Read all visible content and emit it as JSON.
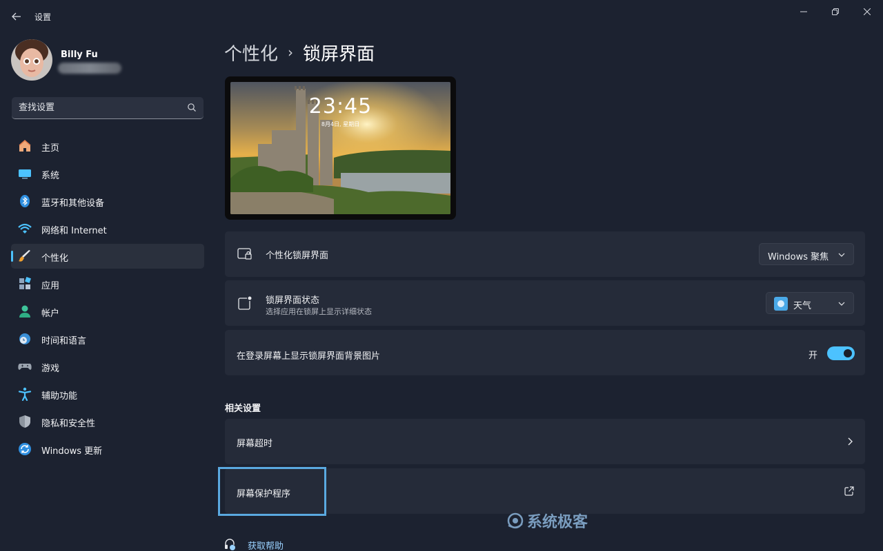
{
  "window": {
    "title": "设置",
    "back_icon": "back-arrow-icon",
    "controls": [
      "minimize-icon",
      "restore-icon",
      "close-icon"
    ]
  },
  "profile": {
    "name": "Billy Fu"
  },
  "search": {
    "placeholder": "查找设置"
  },
  "sidebar": {
    "items": [
      {
        "label": "主页",
        "icon": "home-icon"
      },
      {
        "label": "系统",
        "icon": "system-icon"
      },
      {
        "label": "蓝牙和其他设备",
        "icon": "bluetooth-icon"
      },
      {
        "label": "网络和 Internet",
        "icon": "wifi-icon"
      },
      {
        "label": "个性化",
        "icon": "brush-icon",
        "active": true
      },
      {
        "label": "应用",
        "icon": "apps-icon"
      },
      {
        "label": "帐户",
        "icon": "account-icon"
      },
      {
        "label": "时间和语言",
        "icon": "clock-globe-icon"
      },
      {
        "label": "游戏",
        "icon": "gamepad-icon"
      },
      {
        "label": "辅助功能",
        "icon": "accessibility-icon"
      },
      {
        "label": "隐私和安全性",
        "icon": "shield-icon"
      },
      {
        "label": "Windows 更新",
        "icon": "update-icon"
      }
    ],
    "accent": "#4cc2ff"
  },
  "breadcrumb": {
    "parent": "个性化",
    "separator": "›",
    "current": "锁屏界面"
  },
  "preview": {
    "time": "23:45",
    "date": "8月4日, 星期日"
  },
  "settings": {
    "personalize_lock": {
      "title": "个性化锁屏界面",
      "value": "Windows 聚焦"
    },
    "lock_status": {
      "title": "锁屏界面状态",
      "subtitle": "选择应用在锁屏上显示详细状态",
      "value": "天气"
    },
    "login_bg": {
      "title": "在登录屏幕上显示锁屏界面背景图片",
      "toggle_label": "开",
      "toggle_on": true
    }
  },
  "related": {
    "heading": "相关设置",
    "items": [
      {
        "title": "屏幕超时",
        "icon": "chevron-right-icon"
      },
      {
        "title": "屏幕保护程序",
        "icon": "external-link-icon"
      }
    ]
  },
  "help": {
    "label": "获取帮助"
  },
  "watermark": {
    "text": "系统极客"
  }
}
